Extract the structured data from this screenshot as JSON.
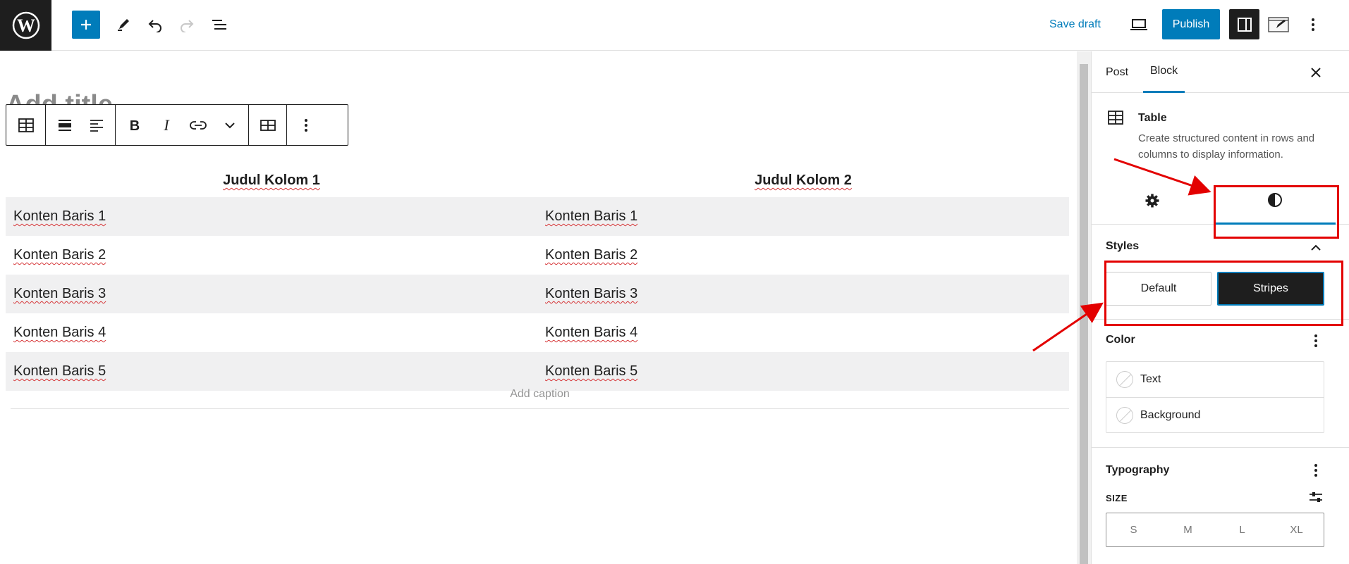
{
  "topbar": {
    "save_draft": "Save draft",
    "publish": "Publish",
    "icons": [
      "wordpress-logo-icon",
      "plus-icon",
      "pencil-icon",
      "undo-icon",
      "redo-icon",
      "list-view-icon",
      "laptop-icon",
      "sidebar-icon",
      "edit-mode-icon",
      "more-vertical-icon"
    ]
  },
  "editor": {
    "title_placeholder": "Add title",
    "table": {
      "headers": [
        "Judul Kolom 1",
        "Judul Kolom 2"
      ],
      "rows": [
        [
          "Konten Baris 1",
          "Konten Baris 1"
        ],
        [
          "Konten Baris 2",
          "Konten Baris 2"
        ],
        [
          "Konten Baris 3",
          "Konten Baris 3"
        ],
        [
          "Konten Baris 4",
          "Konten Baris 4"
        ],
        [
          "Konten Baris 5",
          "Konten Baris 5"
        ]
      ],
      "caption_placeholder": "Add caption"
    },
    "toolbar_icons": [
      "table-icon",
      "align-wide-icon",
      "align-left-icon",
      "bold-icon",
      "italic-icon",
      "link-icon",
      "chevron-down-icon",
      "edit-table-icon",
      "more-vertical-icon"
    ]
  },
  "sidebar": {
    "tabs": [
      "Post",
      "Block"
    ],
    "active_tab": "Block",
    "block": {
      "name": "Table",
      "description": "Create structured content in rows and columns to display information."
    },
    "styles": {
      "heading": "Styles",
      "options": [
        "Default",
        "Stripes"
      ],
      "selected": "Stripes"
    },
    "color": {
      "heading": "Color",
      "items": [
        "Text",
        "Background"
      ]
    },
    "typography": {
      "heading": "Typography",
      "size_label": "SIZE",
      "sizes": [
        "S",
        "M",
        "L",
        "XL"
      ]
    }
  },
  "colors": {
    "accent": "#007cba",
    "dark": "#1e1e1e",
    "stripe": "#f0f0f1",
    "annotation": "#e30000"
  }
}
